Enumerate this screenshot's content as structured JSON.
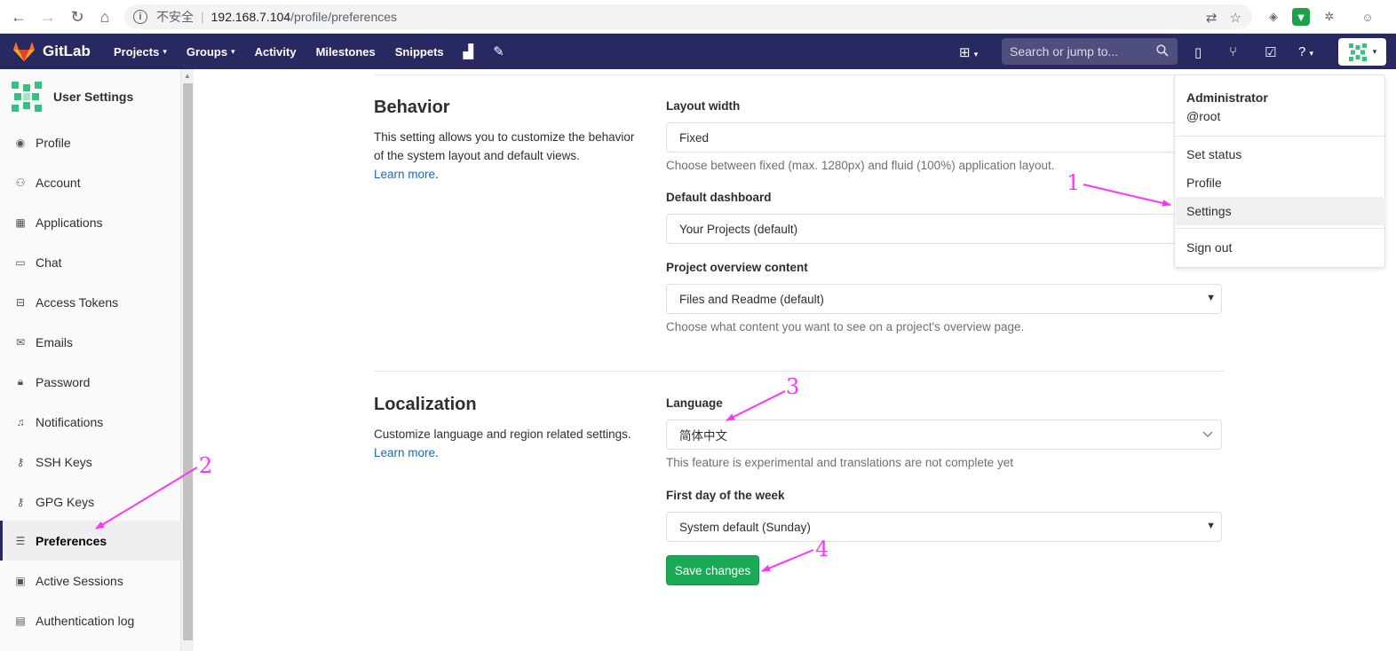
{
  "browser": {
    "insecure_label": "不安全",
    "url_host": "192.168.7.104",
    "url_path": "/profile/preferences"
  },
  "navbar": {
    "logo_text": "GitLab",
    "items": [
      {
        "label": "Projects",
        "has_caret": true
      },
      {
        "label": "Groups",
        "has_caret": true
      },
      {
        "label": "Activity"
      },
      {
        "label": "Milestones"
      },
      {
        "label": "Snippets"
      }
    ],
    "search_placeholder": "Search or jump to..."
  },
  "sidebar": {
    "title": "User Settings",
    "items": [
      {
        "label": "Profile",
        "icon": "profile-icon"
      },
      {
        "label": "Account",
        "icon": "account-icon"
      },
      {
        "label": "Applications",
        "icon": "applications-icon"
      },
      {
        "label": "Chat",
        "icon": "chat-icon"
      },
      {
        "label": "Access Tokens",
        "icon": "token-icon"
      },
      {
        "label": "Emails",
        "icon": "envelope-icon"
      },
      {
        "label": "Password",
        "icon": "lock-icon"
      },
      {
        "label": "Notifications",
        "icon": "bell-icon"
      },
      {
        "label": "SSH Keys",
        "icon": "key-icon"
      },
      {
        "label": "GPG Keys",
        "icon": "key-icon"
      },
      {
        "label": "Preferences",
        "icon": "preferences-icon",
        "active": true
      },
      {
        "label": "Active Sessions",
        "icon": "monitor-icon"
      },
      {
        "label": "Authentication log",
        "icon": "log-icon"
      }
    ]
  },
  "behavior": {
    "title": "Behavior",
    "desc": "This setting allows you to customize the behavior of the system layout and default views.",
    "learn_more": "Learn more",
    "layout_width_label": "Layout width",
    "layout_width_value": "Fixed",
    "layout_width_help": "Choose between fixed (max. 1280px) and fluid (100%) application layout.",
    "dashboard_label": "Default dashboard",
    "dashboard_value": "Your Projects (default)",
    "overview_label": "Project overview content",
    "overview_value": "Files and Readme (default)",
    "overview_help": "Choose what content you want to see on a project's overview page."
  },
  "localization": {
    "title": "Localization",
    "desc": "Customize language and region related settings.",
    "learn_more": "Learn more",
    "language_label": "Language",
    "language_value": "简体中文",
    "language_help": "This feature is experimental and translations are not complete yet",
    "first_day_label": "First day of the week",
    "first_day_value": "System default (Sunday)",
    "save_label": "Save changes"
  },
  "user_dropdown": {
    "name": "Administrator",
    "handle": "@root",
    "items": [
      "Set status",
      "Profile",
      "Settings",
      "Sign out"
    ],
    "hover_item": "Settings"
  },
  "annotations": [
    "1",
    "2",
    "3",
    "4"
  ],
  "colors": {
    "navbar": "#292961",
    "save_button": "#1aaa55",
    "link": "#1b69b6",
    "annotation": "#ff33ff"
  }
}
